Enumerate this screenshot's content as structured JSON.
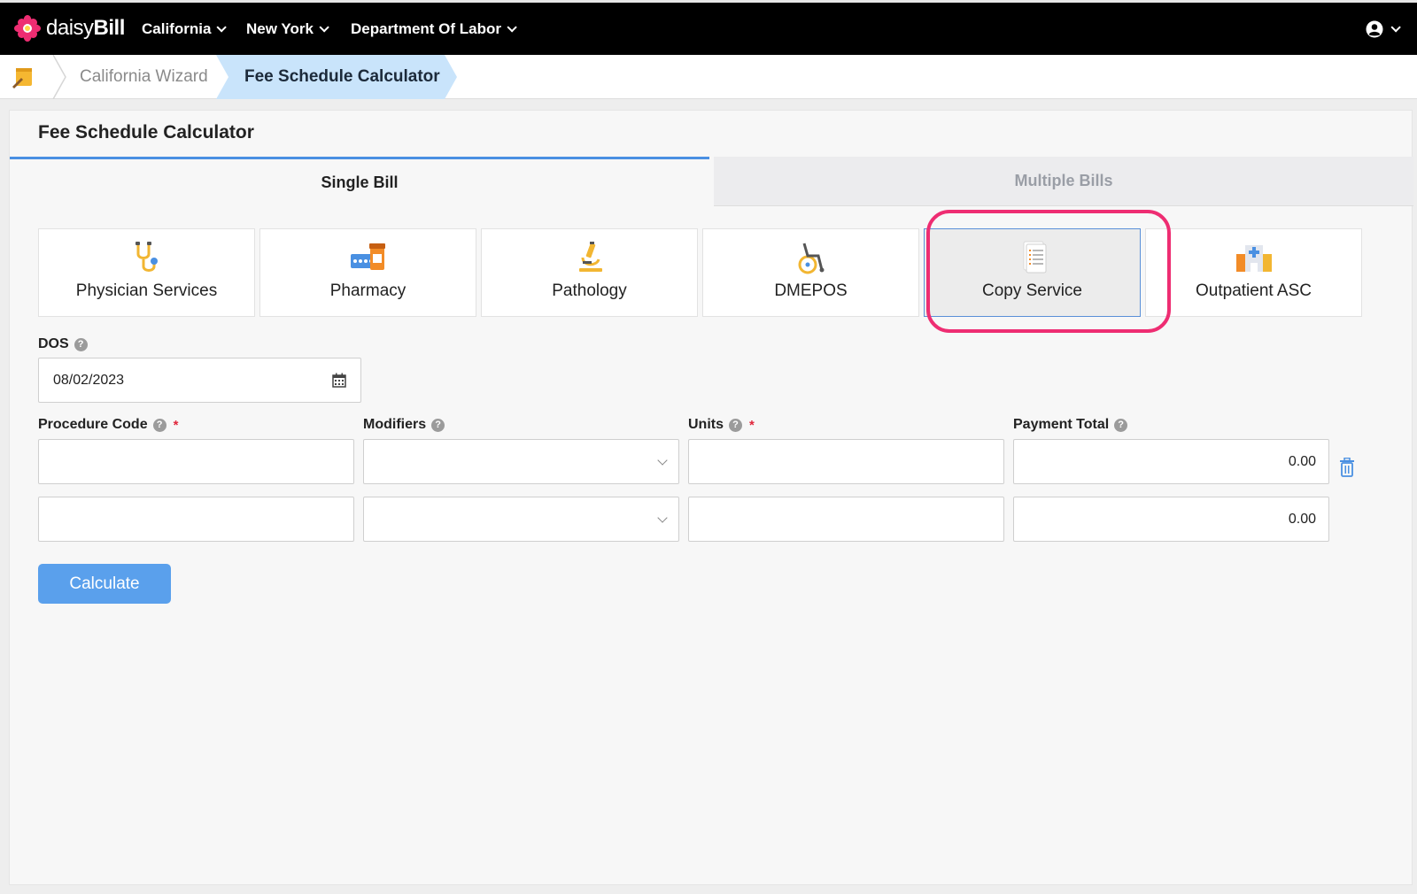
{
  "app": {
    "logo_text_light": "daisy",
    "logo_text_bold": "Bill",
    "colors": {
      "accent": "#4a90e2",
      "brand_pink": "#ee2d72",
      "nav_bg": "#000000",
      "button": "#5aa0ec"
    }
  },
  "nav": {
    "menus": [
      {
        "label": "California"
      },
      {
        "label": "New York"
      },
      {
        "label": "Department Of Labor"
      }
    ],
    "user_icon": "user-circle-icon"
  },
  "breadcrumb": {
    "home_icon": "notepad-icon",
    "items": [
      {
        "label": "California Wizard"
      },
      {
        "label": "Fee Schedule Calculator"
      }
    ]
  },
  "panel": {
    "title": "Fee Schedule Calculator",
    "tabs": [
      {
        "label": "Single Bill",
        "active": true
      },
      {
        "label": "Multiple Bills",
        "active": false
      }
    ],
    "categories": [
      {
        "label": "Physician Services",
        "icon": "stethoscope-icon"
      },
      {
        "label": "Pharmacy",
        "icon": "pill-bottle-icon"
      },
      {
        "label": "Pathology",
        "icon": "microscope-icon"
      },
      {
        "label": "DMEPOS",
        "icon": "wheelchair-icon"
      },
      {
        "label": "Copy Service",
        "icon": "document-icon",
        "selected": true
      },
      {
        "label": "Outpatient ASC",
        "icon": "hospital-icon"
      }
    ]
  },
  "form": {
    "dos": {
      "label": "DOS",
      "value": "08/02/2023"
    },
    "columns": {
      "procedure": "Procedure Code",
      "modifiers": "Modifiers",
      "units": "Units",
      "payment": "Payment Total"
    },
    "rows": [
      {
        "procedure": "",
        "modifiers": "",
        "units": "",
        "payment": "0.00"
      },
      {
        "procedure": "",
        "modifiers": "",
        "units": "",
        "payment": "0.00"
      }
    ],
    "required_mark": "*",
    "help_glyph": "?",
    "calculate_label": "Calculate"
  }
}
